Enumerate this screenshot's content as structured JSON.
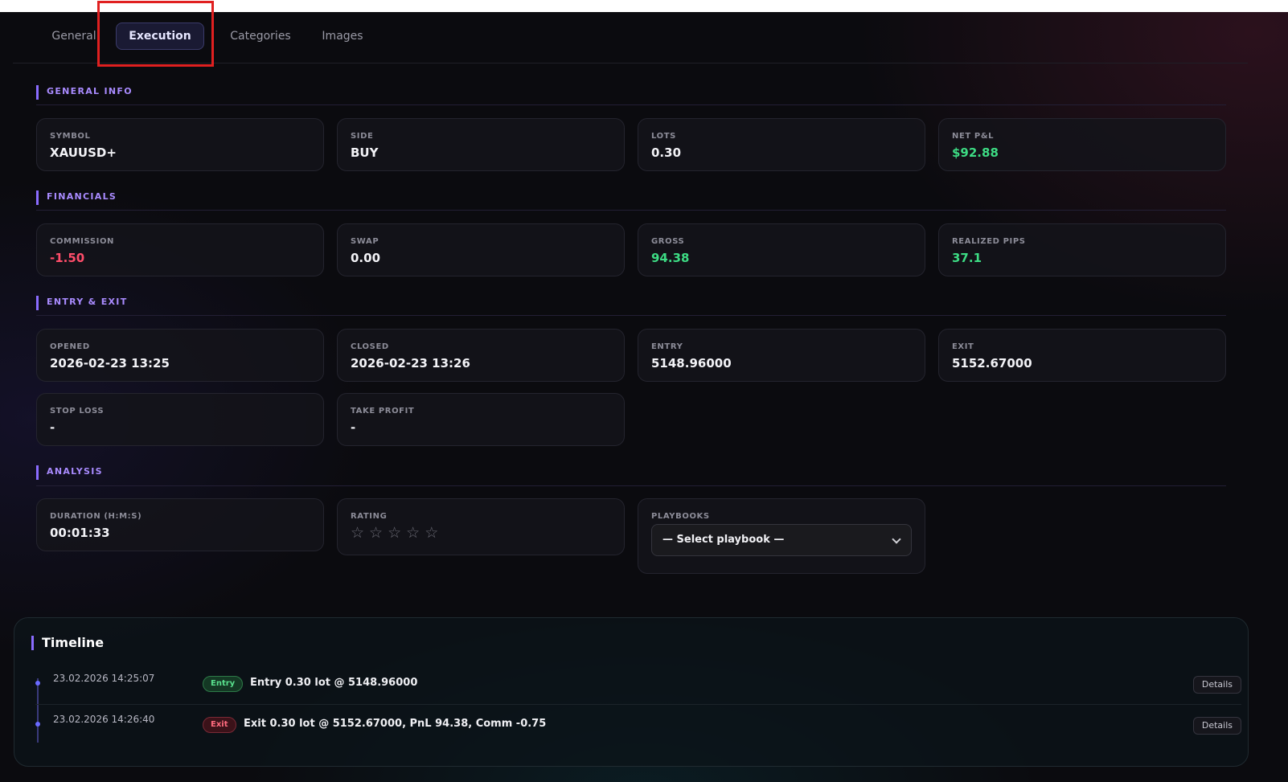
{
  "tabs": [
    "General",
    "Execution",
    "Categories",
    "Images"
  ],
  "active_tab": "Execution",
  "sections": {
    "general_info": {
      "title": "GENERAL INFO",
      "fields": [
        {
          "label": "SYMBOL",
          "value": "XAUUSD+"
        },
        {
          "label": "SIDE",
          "value": "BUY"
        },
        {
          "label": "LOTS",
          "value": "0.30"
        },
        {
          "label": "NET P&L",
          "value": "$92.88"
        }
      ]
    },
    "financials": {
      "title": "FINANCIALS",
      "fields": [
        {
          "label": "COMMISSION",
          "value": "-1.50"
        },
        {
          "label": "SWAP",
          "value": "0.00"
        },
        {
          "label": "GROSS",
          "value": "94.38"
        },
        {
          "label": "REALIZED PIPS",
          "value": "37.1"
        }
      ]
    },
    "entry_exit": {
      "title": "ENTRY & EXIT",
      "fields": [
        {
          "label": "OPENED",
          "value": "2026-02-23 13:25"
        },
        {
          "label": "CLOSED",
          "value": "2026-02-23 13:26"
        },
        {
          "label": "ENTRY",
          "value": "5148.96000"
        },
        {
          "label": "EXIT",
          "value": "5152.67000"
        },
        {
          "label": "STOP LOSS",
          "value": "-"
        },
        {
          "label": "TAKE PROFIT",
          "value": "-"
        }
      ]
    },
    "analysis": {
      "title": "ANALYSIS",
      "duration": {
        "label": "DURATION (H:M:S)",
        "value": "00:01:33"
      },
      "rating": {
        "label": "RATING",
        "stars": 0,
        "max": 5
      },
      "playbooks": {
        "label": "PLAYBOOKS",
        "selected": "— Select playbook —"
      }
    }
  },
  "timeline": {
    "title": "Timeline",
    "events": [
      {
        "time": "23.02.2026 14:25:07",
        "badge": "Entry",
        "text": "Entry 0.30 lot @ 5148.96000",
        "action": "Details"
      },
      {
        "time": "23.02.2026 14:26:40",
        "badge": "Exit",
        "text": "Exit 0.30 lot @ 5152.67000, PnL 94.38, Comm -0.75",
        "action": "Details"
      }
    ]
  },
  "colors": {
    "accent": "#8a6cff",
    "positive": "#3ddc84",
    "negative": "#ff4d6a",
    "highlight": "#e02020"
  }
}
